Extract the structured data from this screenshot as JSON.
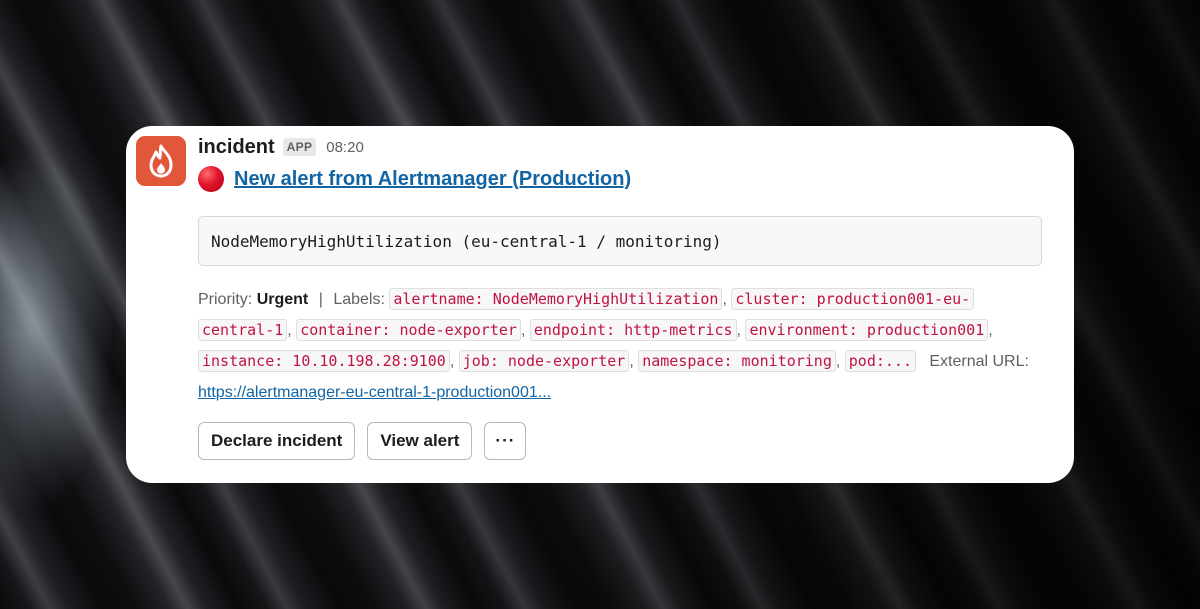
{
  "message": {
    "sender": "incident",
    "badge": "APP",
    "time": "08:20",
    "title_emoji": "red-circle",
    "title": "New alert from Alertmanager (Production)",
    "code_block": "NodeMemoryHighUtilization (eu-central-1 / monitoring)",
    "priority_label": "Priority:",
    "priority_value": "Urgent",
    "separator": "|",
    "labels_label": "Labels:",
    "labels": [
      "alertname: NodeMemoryHighUtilization",
      "cluster: production001-eu-central-1",
      "container: node-exporter",
      "endpoint: http-metrics",
      "environment: production001",
      "instance: 10.10.198.28:9100",
      "job: node-exporter",
      "namespace: monitoring",
      "pod:..."
    ],
    "label_separator": ",",
    "external_url_label": "External URL:",
    "external_url": "https://alertmanager-eu-central-1-production001..."
  },
  "buttons": {
    "declare": "Declare incident",
    "view": "View alert",
    "more": "···"
  },
  "colors": {
    "avatar": "#e2563a",
    "link": "#1264a3",
    "label_code": "#c01343",
    "status_dot": "#e0142a"
  },
  "icons": {
    "avatar": "flame-icon",
    "status": "red-circle-icon",
    "more": "ellipsis-icon"
  }
}
